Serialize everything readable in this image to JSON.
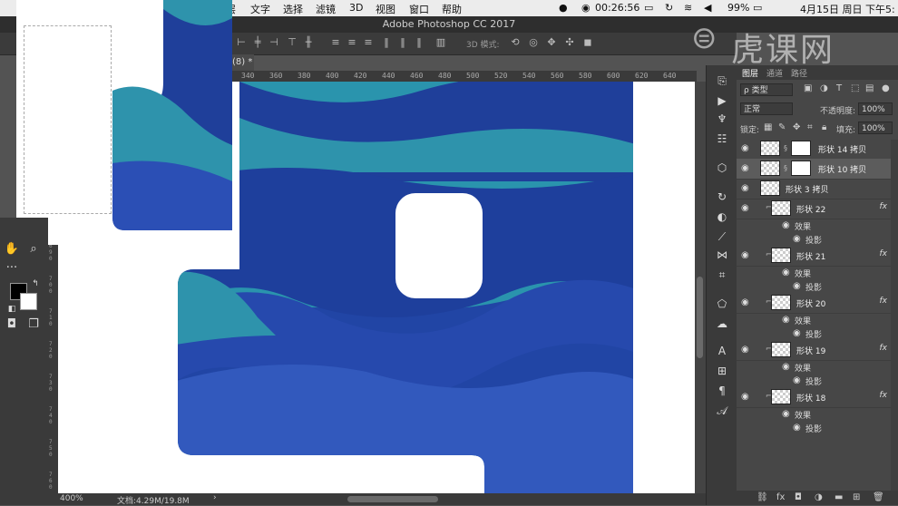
{
  "menubar": {
    "items": [
      "层",
      "文字",
      "选择",
      "滤镜",
      "3D",
      "视图",
      "窗口",
      "帮助"
    ],
    "time": "00:26:56",
    "battery": "99%",
    "date": "4月15日 周日 下午5:"
  },
  "app": {
    "title": "Adobe Photoshop CC 2017"
  },
  "options": {
    "three_d_mode": "3D 模式:"
  },
  "document": {
    "tab_label": "(8) *",
    "zoom": "400%",
    "doc_info": "文档:4.29M/19.8M"
  },
  "ruler": {
    "top": [
      "340",
      "360",
      "380",
      "400",
      "420",
      "440",
      "460",
      "480",
      "500",
      "520",
      "540",
      "560",
      "580",
      "600",
      "620",
      "640"
    ],
    "left": [
      "6 4 0",
      "6 5 0",
      "6 6 0",
      "6 7 0",
      "6 8 0",
      "6 9 0",
      "7 0 0",
      "7 1 0",
      "7 2 0",
      "7 3 0",
      "7 4 0",
      "7 5 0",
      "7 6 0"
    ]
  },
  "watermark": {
    "text": "虎课网"
  },
  "layers_panel": {
    "tabs": [
      "图层",
      "通道",
      "路径"
    ],
    "filter_kind": "ρ 类型",
    "blend_mode": "正常",
    "opacity_label": "不透明度:",
    "opacity_value": "100%",
    "lock_label": "锁定:",
    "fill_label": "填充:",
    "fill_value": "100%",
    "layers": [
      {
        "name": "形状 14 拷贝",
        "has_mask": true,
        "fx": false,
        "selected": false
      },
      {
        "name": "形状 10 拷贝",
        "has_mask": true,
        "fx": false,
        "selected": true
      },
      {
        "name": "形状 3 拷贝",
        "has_mask": false,
        "fx": false,
        "selected": false
      },
      {
        "name": "形状 22",
        "has_mask": false,
        "fx": true,
        "selected": false
      },
      {
        "name": "形状 21",
        "has_mask": false,
        "fx": true,
        "selected": false
      },
      {
        "name": "形状 20",
        "has_mask": false,
        "fx": true,
        "selected": false
      },
      {
        "name": "形状 19",
        "has_mask": false,
        "fx": true,
        "selected": false
      },
      {
        "name": "形状 18",
        "has_mask": false,
        "fx": true,
        "selected": false
      }
    ],
    "effects_label": "效果",
    "shadow_label": "投影",
    "fx_label": "fx"
  },
  "colors": {
    "wave_dark": "#1f3f9a",
    "wave_mid": "#2b4fb5",
    "wave_light": "#3a5fc2",
    "wave_teal": "#2e93ac"
  }
}
